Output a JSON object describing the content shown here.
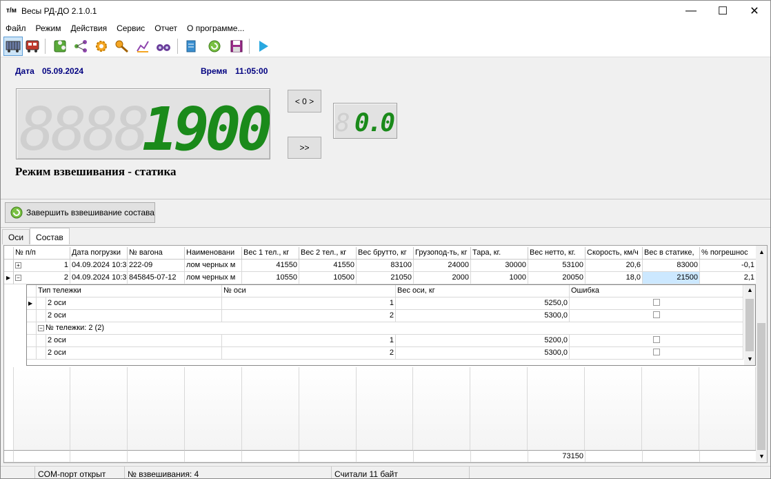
{
  "window": {
    "title": "Весы РД-ДО 2.1.0.1",
    "app_icon": "т/м",
    "minimize": "—",
    "maximize": "☐",
    "close": "✕"
  },
  "menu": [
    "Файл",
    "Режим",
    "Действия",
    "Сервис",
    "Отчет",
    "О программе..."
  ],
  "toolbar_icons": [
    "railcar-scale-icon",
    "train-icon",
    "puzzle-icon",
    "share-icon",
    "gear-icon",
    "key-icon",
    "chart-icon",
    "binoculars-icon",
    "scroll-icon",
    "refresh-icon",
    "floppy-icon",
    "play-icon"
  ],
  "info": {
    "date_label": "Дата",
    "date_value": "05.09.2024",
    "time_label": "Время",
    "time_value": "11:05:00"
  },
  "display": {
    "main_value": "1900",
    "small_value": "0.0",
    "zero_button": "< 0 >",
    "next_button": ">>"
  },
  "mode_title": "Режим взвешивания - статика",
  "finish_button": "Завершить взвешивание состава",
  "tabs": [
    "Оси",
    "Состав"
  ],
  "grid": {
    "columns": [
      "№ п/п",
      "Дата погрузки",
      "№ вагона",
      "Наименовани",
      "Вес 1 тел., кг",
      "Вес 2 тел., кг",
      "Вес брутто, кг",
      "Грузопод-ть, кг",
      "Тара, кг.",
      "Вес нетто, кг.",
      "Скорость, км/ч",
      "Вес в статике,",
      "% погрешнос"
    ],
    "rows": [
      [
        "1",
        "04.09.2024 10:3",
        "222-09",
        "лом черных м",
        "41550",
        "41550",
        "83100",
        "24000",
        "30000",
        "53100",
        "20,6",
        "83000",
        "-0,1"
      ],
      [
        "2",
        "04.09.2024 10:3",
        "845845-07-12",
        "лом черных м",
        "10550",
        "10500",
        "21050",
        "2000",
        "1000",
        "20050",
        "18,0",
        "21500",
        "2,1"
      ]
    ],
    "total_netto": "73150"
  },
  "subgrid": {
    "columns": [
      "Тип тележки",
      "№ оси",
      "Вес оси, кг",
      "Ошибка"
    ],
    "group_label": "№ тележки: 2 (2)",
    "rows_a": [
      [
        "2 оси",
        "1",
        "5250,0"
      ],
      [
        "2 оси",
        "2",
        "5300,0"
      ]
    ],
    "rows_b": [
      [
        "2 оси",
        "1",
        "5200,0"
      ],
      [
        "2 оси",
        "2",
        "5300,0"
      ]
    ]
  },
  "status": {
    "com": "COM-порт открыт",
    "weighing": "№ взвешивания: 4",
    "bytes": "Считали 11 байт"
  }
}
